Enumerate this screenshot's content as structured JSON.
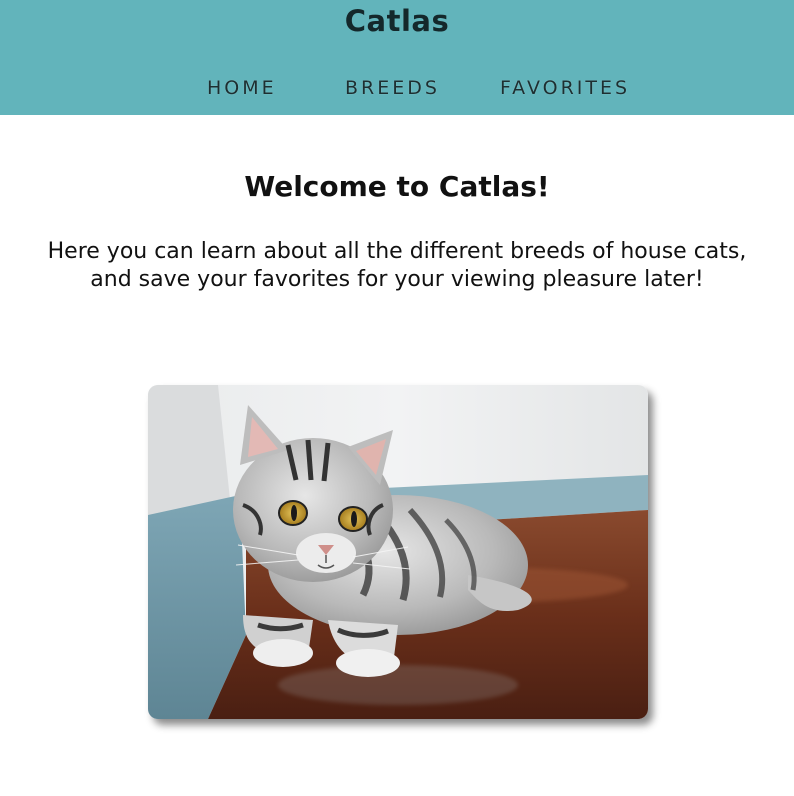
{
  "header": {
    "title": "Catlas",
    "background": "#62b4bb",
    "nav": [
      {
        "label": "HOME"
      },
      {
        "label": "BREEDS"
      },
      {
        "label": "FAVORITES"
      }
    ]
  },
  "main": {
    "heading": "Welcome to Catlas!",
    "intro": "Here you can learn about all the different breeds of house cats, and save your favorites for your viewing pleasure later!",
    "hero_image": {
      "subject": "silver tabby cat lying on a wooden floor"
    }
  }
}
